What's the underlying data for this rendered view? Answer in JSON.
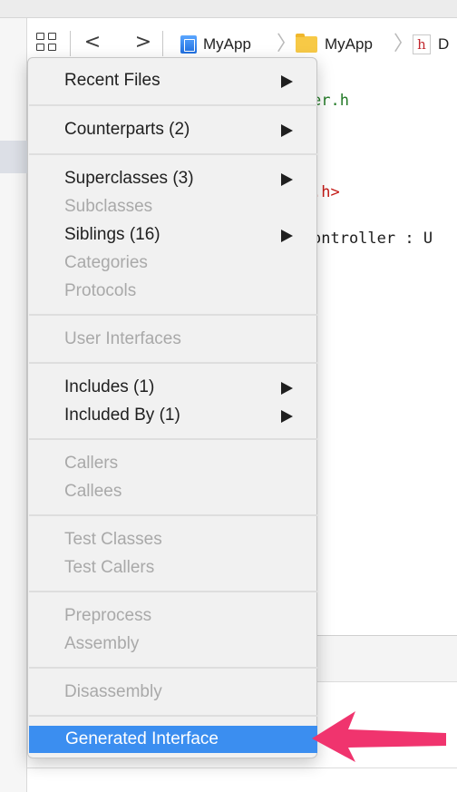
{
  "jump_bar": {
    "back_glyph": "<",
    "forward_glyph": ">",
    "crumbs": [
      {
        "label": "MyApp",
        "icon": "xcode-project-icon"
      },
      {
        "label": "MyApp",
        "icon": "folder-icon"
      },
      {
        "label": "D",
        "icon": "header-file-icon",
        "icon_text": "h"
      }
    ],
    "separator_glyph": "〉"
  },
  "editor": {
    "lines": [
      {
        "text": "er.h",
        "color": "green"
      },
      {
        "text": ".h>",
        "color": "red"
      },
      {
        "text": "ontroller : U",
        "color": "black"
      }
    ]
  },
  "context_menu": {
    "items": [
      {
        "label": "Recent Files",
        "enabled": true,
        "submenu": true
      },
      {
        "label": "Counterparts (2)",
        "enabled": true,
        "submenu": true
      },
      {
        "label": "Superclasses (3)",
        "enabled": true,
        "submenu": true
      },
      {
        "label": "Subclasses",
        "enabled": false,
        "submenu": false
      },
      {
        "label": "Siblings (16)",
        "enabled": true,
        "submenu": true
      },
      {
        "label": "Categories",
        "enabled": false,
        "submenu": false
      },
      {
        "label": "Protocols",
        "enabled": false,
        "submenu": false
      },
      {
        "label": "User Interfaces",
        "enabled": false,
        "submenu": false
      },
      {
        "label": "Includes (1)",
        "enabled": true,
        "submenu": true
      },
      {
        "label": "Included By (1)",
        "enabled": true,
        "submenu": true
      },
      {
        "label": "Callers",
        "enabled": false,
        "submenu": false
      },
      {
        "label": "Callees",
        "enabled": false,
        "submenu": false
      },
      {
        "label": "Test Classes",
        "enabled": false,
        "submenu": false
      },
      {
        "label": "Test Callers",
        "enabled": false,
        "submenu": false
      },
      {
        "label": "Preprocess",
        "enabled": false,
        "submenu": false
      },
      {
        "label": "Assembly",
        "enabled": false,
        "submenu": false
      },
      {
        "label": "Disassembly",
        "enabled": false,
        "submenu": false
      },
      {
        "label": "Generated Interface",
        "enabled": true,
        "submenu": false,
        "highlighted": true
      }
    ]
  },
  "colors": {
    "highlight": "#3b8ef0",
    "annotation_arrow": "#f0346e",
    "menu_background": "#f1f1f1",
    "disabled_text": "#a9a9a9"
  },
  "annotation": {
    "icon": "pink-callout-arrow-icon"
  }
}
